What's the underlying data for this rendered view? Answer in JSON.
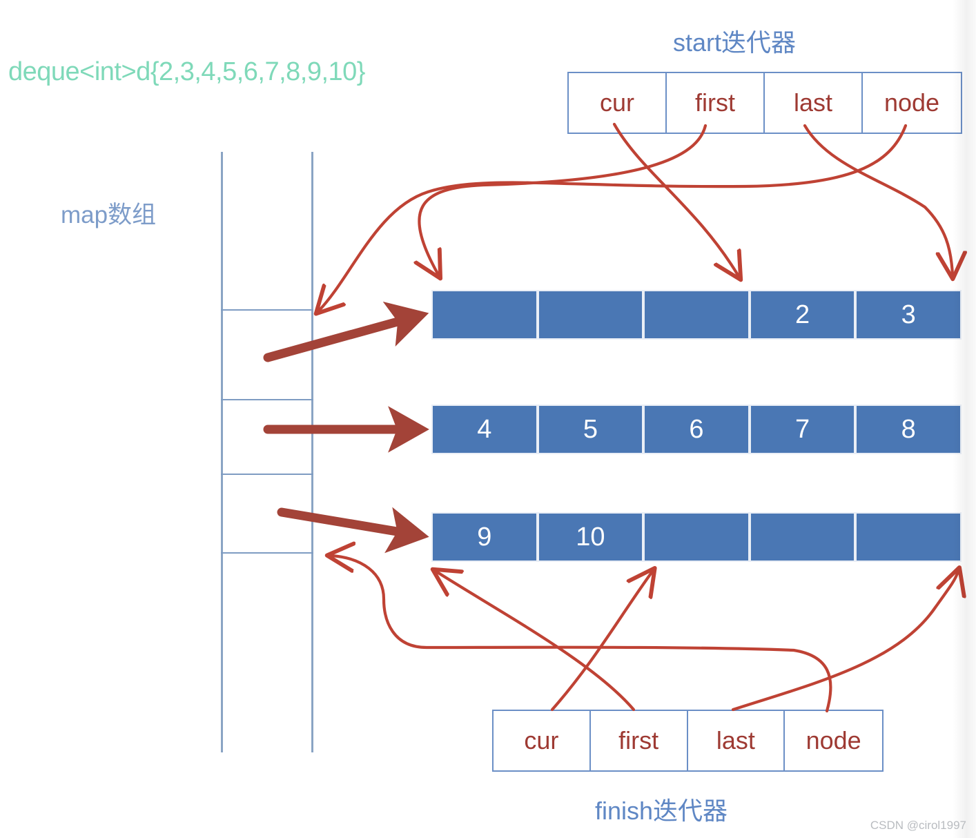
{
  "code_caption": "deque<int>d{2,3,4,5,6,7,8,9,10}",
  "labels": {
    "map_array": "map数组",
    "start_iterator": "start迭代器",
    "finish_iterator": "finish迭代器"
  },
  "start_iterator": {
    "fields": [
      {
        "name": "cur"
      },
      {
        "name": "first"
      },
      {
        "name": "last"
      },
      {
        "name": "node"
      }
    ]
  },
  "finish_iterator": {
    "fields": [
      {
        "name": "cur"
      },
      {
        "name": "first"
      },
      {
        "name": "last"
      },
      {
        "name": "node"
      }
    ]
  },
  "buffers": [
    {
      "id": "buffer-1",
      "cells": [
        "",
        "",
        "",
        "2",
        "3"
      ]
    },
    {
      "id": "buffer-2",
      "cells": [
        "4",
        "5",
        "6",
        "7",
        "8"
      ]
    },
    {
      "id": "buffer-3",
      "cells": [
        "9",
        "10",
        "",
        "",
        ""
      ]
    }
  ],
  "map_array": {
    "segments": 5,
    "divider_positions": [
      448,
      578,
      686,
      800
    ]
  },
  "colors": {
    "buffer_fill": "#4a77b4",
    "buffer_text": "#ffffff",
    "iterator_border": "#6b8fc6",
    "iterator_text": "#9e3a33",
    "title_blue": "#5f87c4",
    "map_label_blue": "#7d9cc9",
    "code_green": "#7fd9b9",
    "thin_arrow": "#bf4234",
    "thick_arrow": "#a34338",
    "map_border": "#8aa4c4"
  },
  "watermark": "CSDN @cirol1997"
}
